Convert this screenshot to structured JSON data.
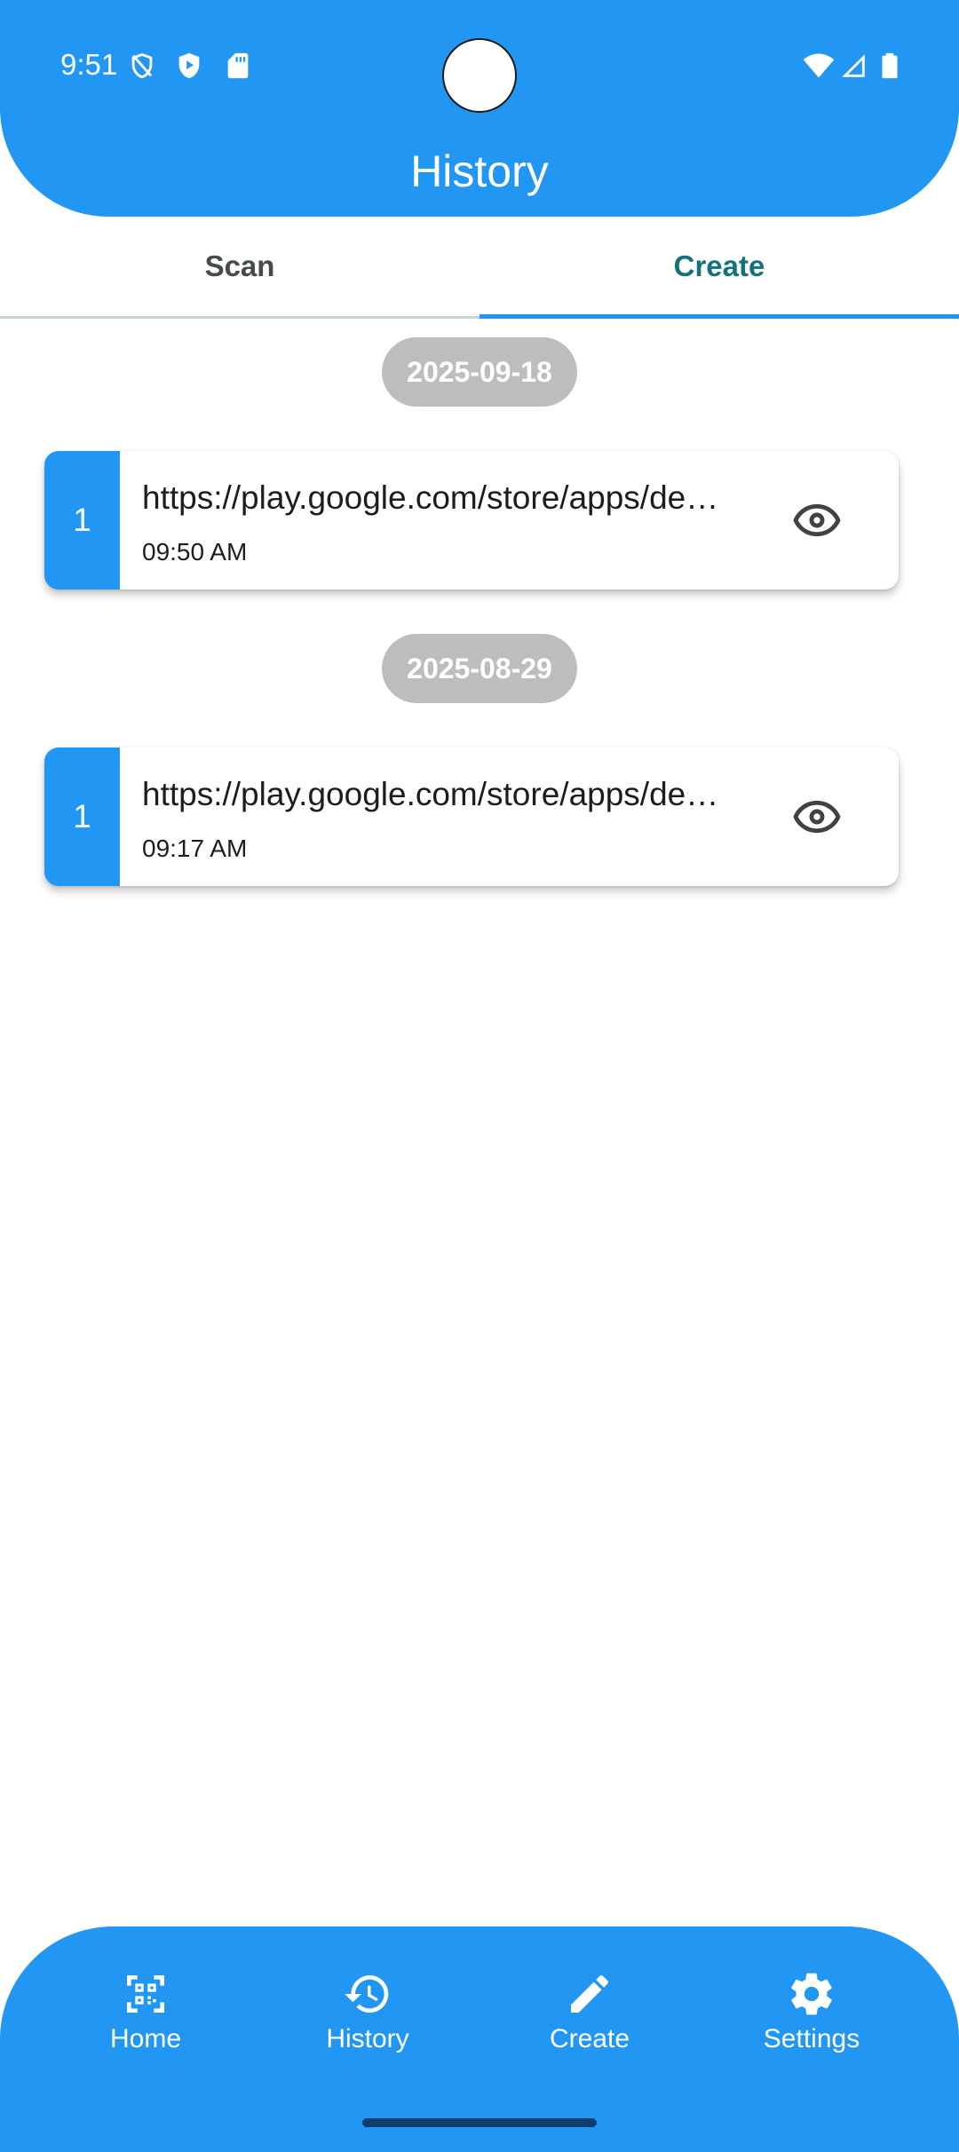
{
  "status_bar": {
    "time": "9:51",
    "left_icons": [
      "shield-outline-icon",
      "shield-play-icon",
      "sd-card-icon"
    ],
    "right_icons": [
      "wifi-icon",
      "signal-icon",
      "battery-icon"
    ]
  },
  "header": {
    "title": "History"
  },
  "tabs": [
    {
      "label": "Scan",
      "selected": false
    },
    {
      "label": "Create",
      "selected": true
    }
  ],
  "groups": [
    {
      "date": "2025-09-18",
      "items": [
        {
          "index": "1",
          "url": "https://play.google.com/store/apps/details",
          "time": "09:50 AM",
          "action_icon": "eye-icon"
        }
      ]
    },
    {
      "date": "2025-08-29",
      "items": [
        {
          "index": "1",
          "url": "https://play.google.com/store/apps/details",
          "time": "09:17 AM",
          "action_icon": "eye-icon"
        }
      ]
    }
  ],
  "bottom_nav": [
    {
      "label": "Home",
      "icon": "qr-code-icon"
    },
    {
      "label": "History",
      "icon": "history-icon"
    },
    {
      "label": "Create",
      "icon": "pencil-icon"
    },
    {
      "label": "Settings",
      "icon": "gear-icon"
    }
  ],
  "colors": {
    "primary": "#2196f3",
    "selected_tab": "#12737d",
    "date_chip": "#bdbdbd"
  }
}
